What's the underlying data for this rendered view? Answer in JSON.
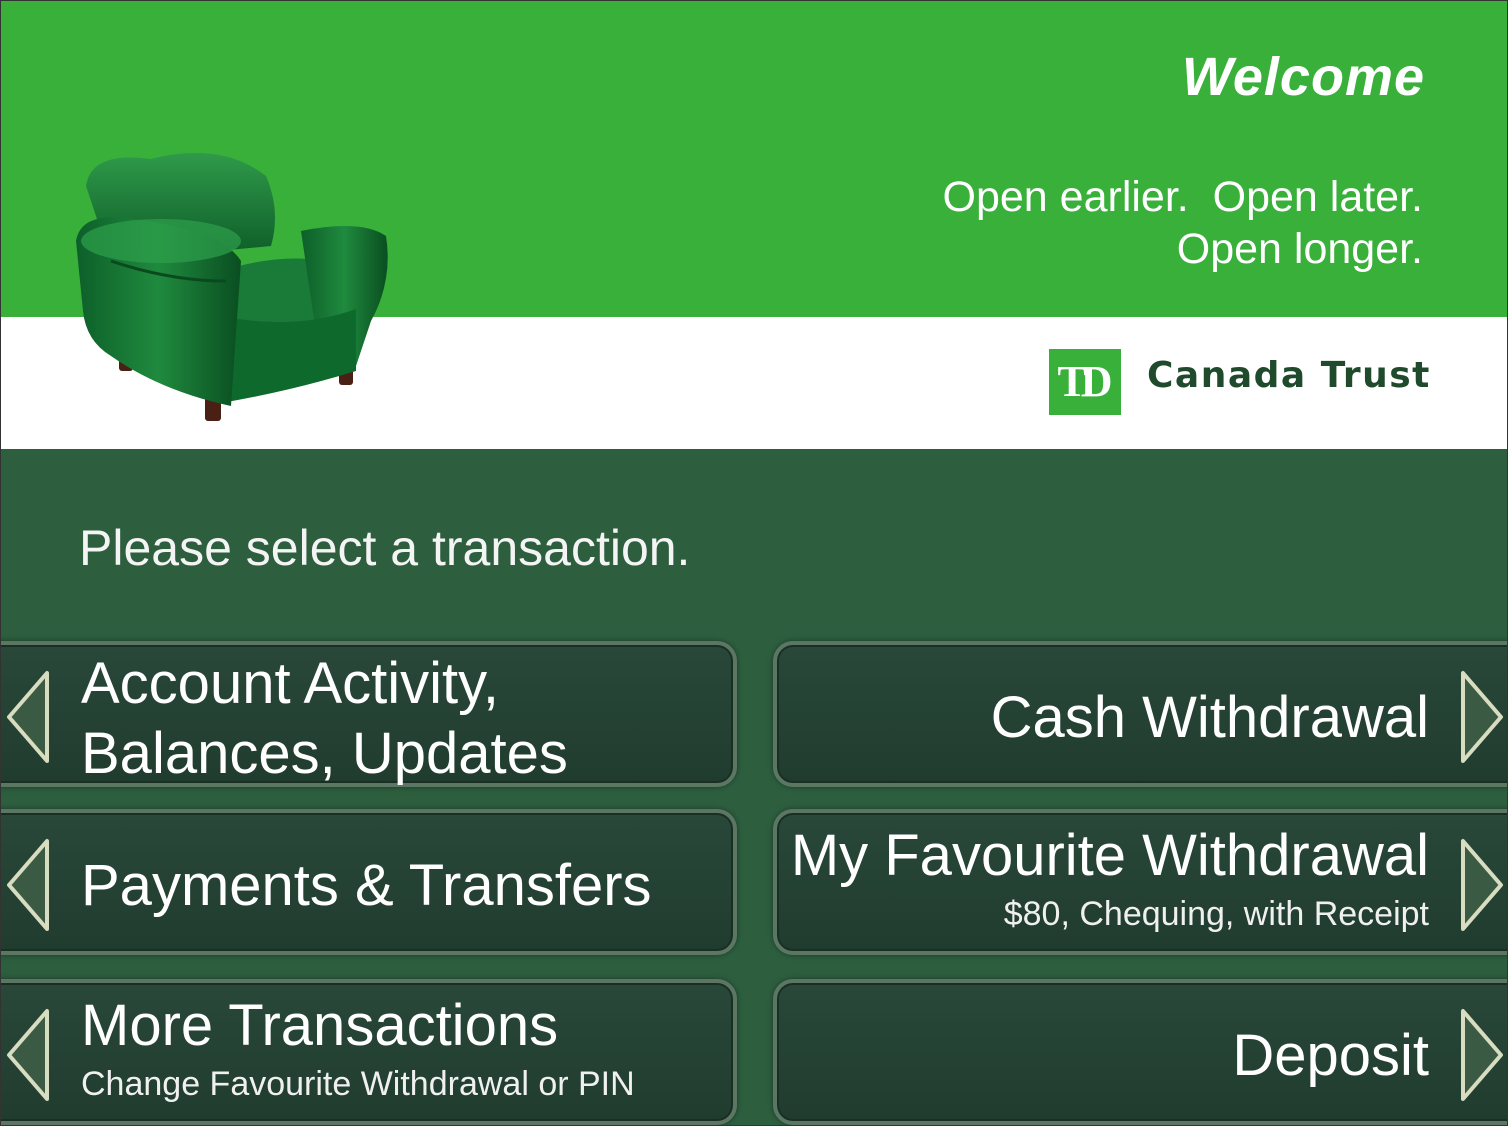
{
  "header": {
    "welcome": "Welcome",
    "tagline_line1": "Open earlier.  Open later.",
    "tagline_line2": "Open longer."
  },
  "brand": {
    "logo_mark": "TD",
    "name": "Canada Trust",
    "green": "#38b03a",
    "dark_green": "#2d5f3f"
  },
  "main": {
    "prompt": "Please select a transaction."
  },
  "transactions": {
    "account_activity": {
      "line1": "Account Activity,",
      "line2": "Balances, Updates"
    },
    "payments": {
      "label": "Payments & Transfers"
    },
    "more": {
      "label": "More Transactions",
      "sub": "Change Favourite Withdrawal or PIN"
    },
    "cash": {
      "label": "Cash Withdrawal"
    },
    "favourite": {
      "label": "My Favourite Withdrawal",
      "sub": "$80, Chequing, with Receipt"
    },
    "deposit": {
      "label": "Deposit"
    }
  },
  "icons": {
    "chair": "armchair-image",
    "arrow_left": "arrow-left-icon",
    "arrow_right": "arrow-right-icon"
  }
}
